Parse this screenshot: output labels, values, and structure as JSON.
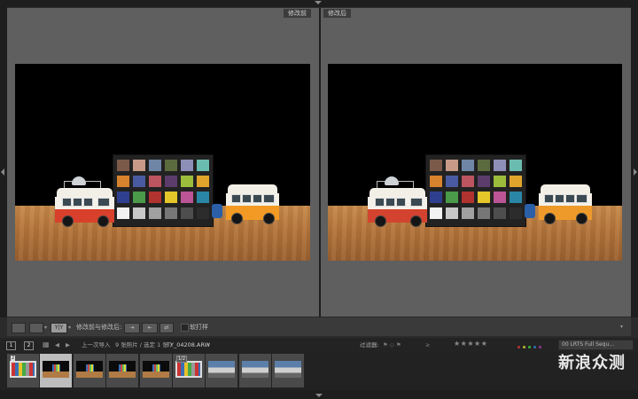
{
  "panes": {
    "before_label": "修改前",
    "after_label": "修改后"
  },
  "toolbar": {
    "view_mode_label": "Y|Y",
    "compare_label": "修改前与修改后:",
    "proof_label": "软打样"
  },
  "filmstrip_bar": {
    "page1": "1",
    "page2": "2",
    "source_label": "上一次导入",
    "count_label": "9 张照片 / 选定 1 张 /",
    "filename": "TY_04208.ARW",
    "filter_label": "过滤器:",
    "stars": "★★★★★",
    "preset_select": "00 LRTS Full Sequ..."
  },
  "thumbnails": [
    {
      "badge": "2",
      "type": "chart",
      "selected": false
    },
    {
      "badge": "",
      "type": "scene",
      "selected": true
    },
    {
      "badge": "",
      "type": "scene",
      "selected": false
    },
    {
      "badge": "",
      "type": "scene",
      "selected": false
    },
    {
      "badge": "",
      "type": "scene",
      "selected": false
    },
    {
      "badge": "1/2",
      "type": "chart",
      "selected": false
    },
    {
      "badge": "",
      "type": "city",
      "selected": false
    },
    {
      "badge": "",
      "type": "city",
      "selected": false
    },
    {
      "badge": "",
      "type": "city",
      "selected": false
    }
  ],
  "watermark": {
    "title": "新浪众测"
  },
  "colors": {
    "accent_selected": "#bdbdbd",
    "pane_bg": "#5f5f5f",
    "app_bg": "#2b2b2b"
  }
}
